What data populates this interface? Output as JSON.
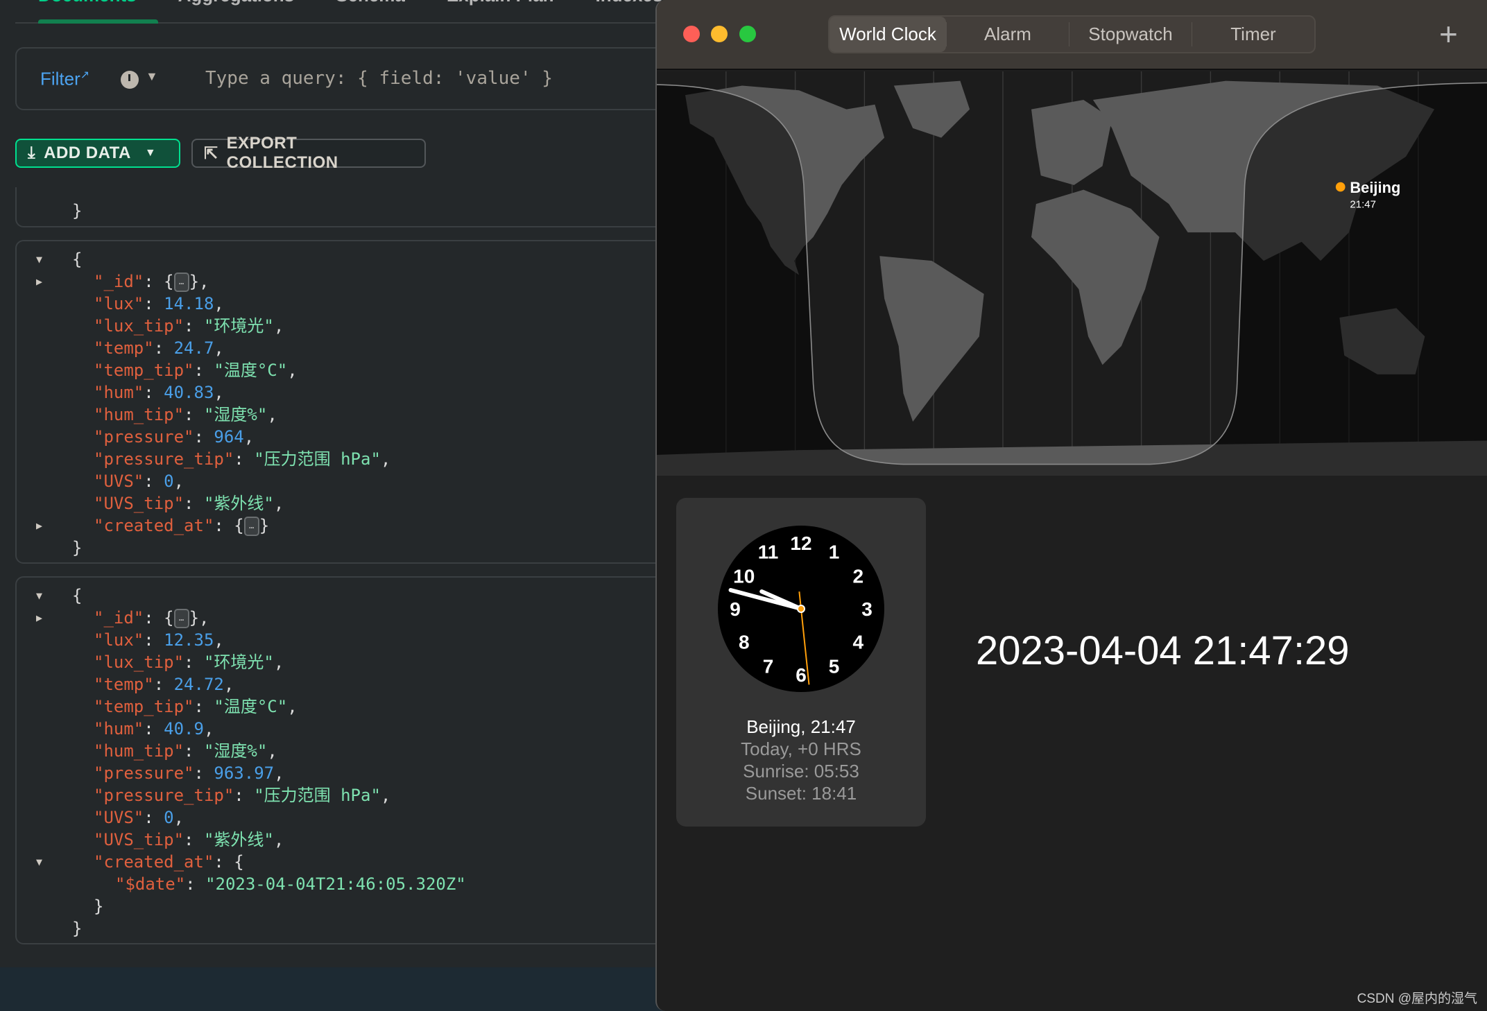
{
  "compass": {
    "tabs": [
      "Documents",
      "Aggregations",
      "Schema",
      "Explain Plan",
      "Indexes"
    ],
    "filter": {
      "label": "Filter",
      "placeholder": "Type a query: { field: 'value' }"
    },
    "buttons": {
      "add_data": "ADD DATA",
      "export": "EXPORT COLLECTION"
    },
    "documents": [
      {
        "lines": [
          {
            "indent": 1,
            "text": "}"
          }
        ]
      },
      {
        "lines": [
          {
            "indent": 1,
            "text": "{",
            "arrow": "down"
          },
          {
            "indent": 2,
            "key": "_id",
            "collapsed": true,
            "arrow": "right"
          },
          {
            "indent": 2,
            "key": "lux",
            "value": "14.18",
            "type": "n"
          },
          {
            "indent": 2,
            "key": "lux_tip",
            "value": "\"环境光\"",
            "type": "s"
          },
          {
            "indent": 2,
            "key": "temp",
            "value": "24.7",
            "type": "n"
          },
          {
            "indent": 2,
            "key": "temp_tip",
            "value": "\"温度°C\"",
            "type": "s"
          },
          {
            "indent": 2,
            "key": "hum",
            "value": "40.83",
            "type": "n"
          },
          {
            "indent": 2,
            "key": "hum_tip",
            "value": "\"湿度%\"",
            "type": "s"
          },
          {
            "indent": 2,
            "key": "pressure",
            "value": "964",
            "type": "n"
          },
          {
            "indent": 2,
            "key": "pressure_tip",
            "value": "\"压力范围 hPa\"",
            "type": "s"
          },
          {
            "indent": 2,
            "key": "UVS",
            "value": "0",
            "type": "n"
          },
          {
            "indent": 2,
            "key": "UVS_tip",
            "value": "\"紫外线\"",
            "type": "s"
          },
          {
            "indent": 2,
            "key": "created_at",
            "collapsed": true,
            "last": true,
            "arrow": "right"
          },
          {
            "indent": 1,
            "text": "}"
          }
        ]
      },
      {
        "lines": [
          {
            "indent": 1,
            "text": "{",
            "arrow": "down"
          },
          {
            "indent": 2,
            "key": "_id",
            "collapsed": true,
            "arrow": "right"
          },
          {
            "indent": 2,
            "key": "lux",
            "value": "12.35",
            "type": "n"
          },
          {
            "indent": 2,
            "key": "lux_tip",
            "value": "\"环境光\"",
            "type": "s"
          },
          {
            "indent": 2,
            "key": "temp",
            "value": "24.72",
            "type": "n"
          },
          {
            "indent": 2,
            "key": "temp_tip",
            "value": "\"温度°C\"",
            "type": "s"
          },
          {
            "indent": 2,
            "key": "hum",
            "value": "40.9",
            "type": "n"
          },
          {
            "indent": 2,
            "key": "hum_tip",
            "value": "\"湿度%\"",
            "type": "s"
          },
          {
            "indent": 2,
            "key": "pressure",
            "value": "963.97",
            "type": "n"
          },
          {
            "indent": 2,
            "key": "pressure_tip",
            "value": "\"压力范围 hPa\"",
            "type": "s"
          },
          {
            "indent": 2,
            "key": "UVS",
            "value": "0",
            "type": "n"
          },
          {
            "indent": 2,
            "key": "UVS_tip",
            "value": "\"紫外线\"",
            "type": "s"
          },
          {
            "indent": 2,
            "key": "created_at",
            "open": true,
            "arrow": "down"
          },
          {
            "indent": 3,
            "key": "$date",
            "value": "\"2023-04-04T21:46:05.320Z\"",
            "type": "s",
            "last": true
          },
          {
            "indent": 2,
            "text": "}"
          },
          {
            "indent": 1,
            "text": "}"
          }
        ]
      }
    ]
  },
  "clock_app": {
    "tabs": [
      "World Clock",
      "Alarm",
      "Stopwatch",
      "Timer"
    ],
    "selected_tab": "World Clock",
    "map_city": {
      "name": "Beijing",
      "time": "21:47"
    },
    "card": {
      "city_time": "Beijing, 21:47",
      "offset": "Today, +0 HRS",
      "sunrise": "Sunrise: 05:53",
      "sunset": "Sunset: 18:41"
    },
    "analog": {
      "hours": 21,
      "minutes": 47,
      "seconds": 29,
      "numerals": [
        "12",
        "1",
        "2",
        "3",
        "4",
        "5",
        "6",
        "7",
        "8",
        "9",
        "10",
        "11"
      ]
    },
    "datetime": "2023-04-04 21:47:29"
  },
  "watermark": "CSDN @屋内的湿气",
  "colors": {
    "key": "#e0603e",
    "number": "#4a9fe8",
    "string": "#7ee2b0",
    "accent": "#00e08f",
    "second_hand": "#ff9f0a",
    "city_dot": "#ff9f0a"
  }
}
